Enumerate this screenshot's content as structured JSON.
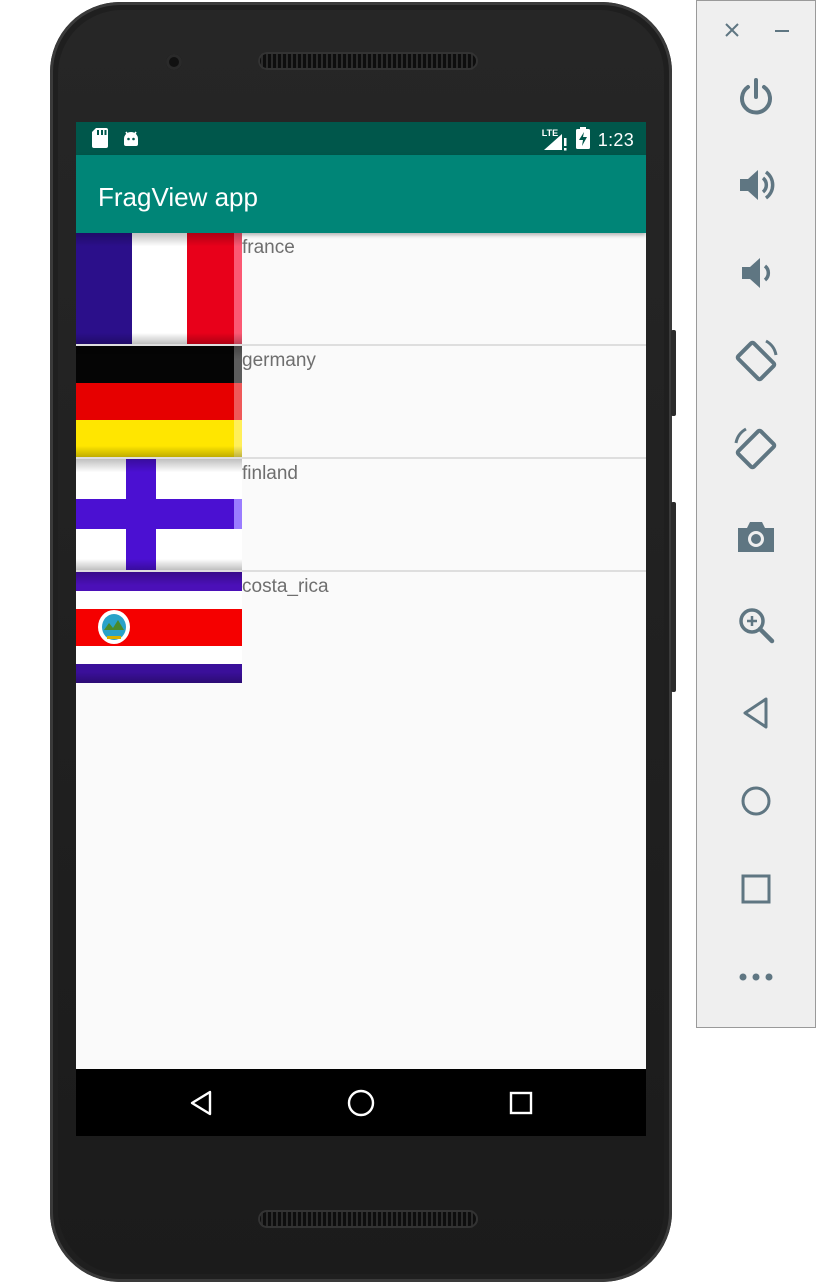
{
  "status_bar": {
    "time": "1:23",
    "network": "LTE",
    "icons": [
      "sd-card-icon",
      "android-icon",
      "signal-icon",
      "battery-charging-icon"
    ]
  },
  "app": {
    "title": "FragView app",
    "toolbar_color": "#008577",
    "status_color": "#00574b"
  },
  "countries": [
    {
      "name": "france"
    },
    {
      "name": "germany"
    },
    {
      "name": "finland"
    },
    {
      "name": "costa_rica"
    }
  ],
  "nav_bar": {
    "buttons": [
      "back-icon",
      "home-icon",
      "recents-icon"
    ]
  },
  "emulator_panel": {
    "window_buttons": [
      "close-icon",
      "minimize-icon"
    ],
    "tools": [
      "power-icon",
      "volume-up-icon",
      "volume-down-icon",
      "rotate-left-icon",
      "rotate-right-icon",
      "camera-icon",
      "zoom-icon",
      "back-icon",
      "home-icon",
      "overview-icon",
      "more-icon"
    ],
    "icon_color": "#5f7682"
  }
}
